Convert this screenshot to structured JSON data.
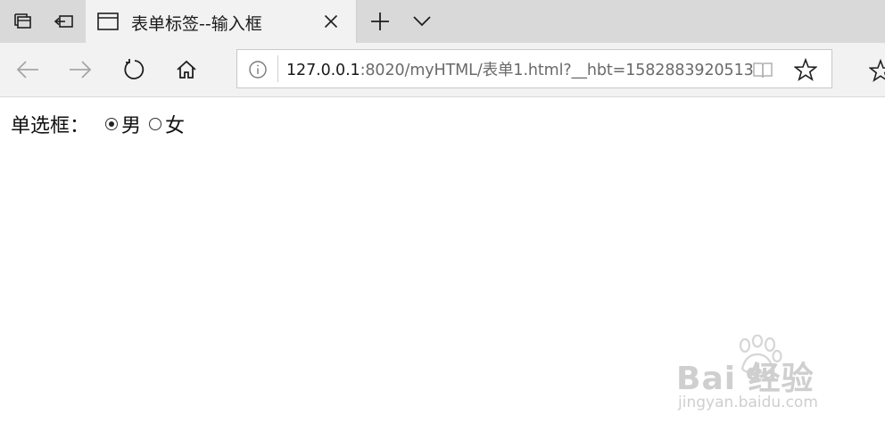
{
  "tab": {
    "title": "表单标签--输入框"
  },
  "address_bar": {
    "url_host": "127.0.0.1",
    "url_rest": ":8020/myHTML/表单1.html?__hbt=1582883920513"
  },
  "form": {
    "label": "单选框：",
    "options": [
      {
        "label": "男",
        "checked": true
      },
      {
        "label": "女",
        "checked": false
      }
    ]
  },
  "watermark": {
    "brand": "Bai  经验",
    "brand_du": "du",
    "site": "jingyan.baidu.com"
  },
  "colors": {
    "tabbar_bg": "#dad9d9",
    "toolbar_bg": "#f2f2f2",
    "accent_text": "#1a1a1a"
  }
}
